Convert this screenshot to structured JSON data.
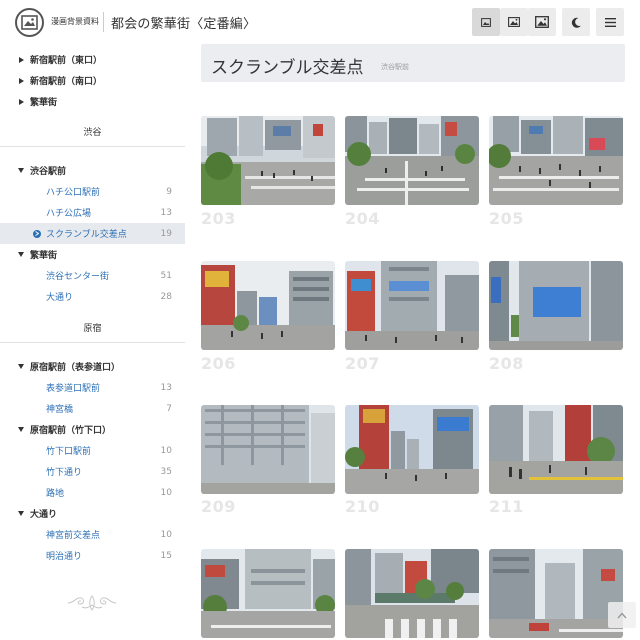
{
  "header": {
    "site_name": "漫画背景資料",
    "page_title": "都会の繁華街〈定番編〉",
    "buttons": [
      {
        "name": "view-small-button",
        "icon": "image-small-icon",
        "active": true
      },
      {
        "name": "view-medium-button",
        "icon": "image-medium-icon",
        "active": false
      },
      {
        "name": "view-large-button",
        "icon": "image-large-icon",
        "active": false
      },
      {
        "name": "dark-mode-button",
        "icon": "moon-icon",
        "active": false
      },
      {
        "name": "menu-button",
        "icon": "hamburger-icon",
        "active": false
      }
    ]
  },
  "sidebar": {
    "top_items": [
      {
        "label": "新宿駅前（東口）"
      },
      {
        "label": "新宿駅前（南口）"
      },
      {
        "label": "繁華街"
      }
    ],
    "sections": [
      {
        "title": "渋谷",
        "groups": [
          {
            "label": "渋谷駅前",
            "children": [
              {
                "label": "ハチ公口駅前",
                "count": "9"
              },
              {
                "label": "ハチ公広場",
                "count": "13"
              },
              {
                "label": "スクランブル交差点",
                "count": "19",
                "selected": true
              }
            ]
          },
          {
            "label": "繁華街",
            "children": [
              {
                "label": "渋谷センター街",
                "count": "51"
              },
              {
                "label": "大通り",
                "count": "28"
              }
            ]
          }
        ]
      },
      {
        "title": "原宿",
        "groups": [
          {
            "label": "原宿駅前（表参道口）",
            "children": [
              {
                "label": "表参道口駅前",
                "count": "13"
              },
              {
                "label": "神宮橋",
                "count": "7"
              }
            ]
          },
          {
            "label": "原宿駅前（竹下口）",
            "children": [
              {
                "label": "竹下口駅前",
                "count": "10"
              },
              {
                "label": "竹下通り",
                "count": "35"
              },
              {
                "label": "路地",
                "count": "10"
              }
            ]
          },
          {
            "label": "大通り",
            "children": [
              {
                "label": "神宮前交差点",
                "count": "10"
              },
              {
                "label": "明治通り",
                "count": "15"
              }
            ]
          }
        ]
      }
    ]
  },
  "main": {
    "title": "スクランブル交差点",
    "subtitle": "渋谷駅前",
    "thumbnails": [
      "203",
      "204",
      "205",
      "206",
      "207",
      "208",
      "209",
      "210",
      "211",
      "",
      "",
      ""
    ]
  },
  "colors": {
    "link": "#2c6fb5",
    "selected_bg": "#e6e9ee",
    "title_bar_bg": "#ebedf0",
    "thumb_number": "#e6e6e6"
  }
}
